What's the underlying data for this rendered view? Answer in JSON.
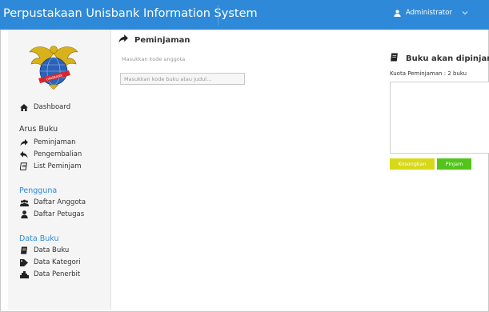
{
  "header": {
    "title": "Perpustakaan Unisbank Information System",
    "user_label": "Administrator"
  },
  "sidebar": {
    "dashboard": "Dashboard",
    "sections": [
      {
        "title": "Arus Buku",
        "items": [
          "Peminjaman",
          "Pengembalian",
          "List Peminjam"
        ]
      },
      {
        "title": "Pengguna",
        "items": [
          "Daftar Anggota",
          "Daftar Petugas"
        ]
      },
      {
        "title": "Data Buku",
        "items": [
          "Data Buku",
          "Data Kategori",
          "Data Penerbit"
        ]
      }
    ]
  },
  "main": {
    "title": "Peminjaman",
    "member_hint": "Masukkan kode anggota",
    "book_input_placeholder": "Masukkan kode buku atau judul...",
    "book_input_value": ""
  },
  "panel": {
    "title": "Buku akan dipinjam",
    "quota": "Kuota Peminjaman : 2 buku",
    "clear_button": "Kosongkan",
    "borrow_button": "Pinjam"
  },
  "colors": {
    "header": "#2e8ad8",
    "section_accent": "#2e8ad8",
    "clear_button": "#d8d818",
    "borrow_button": "#52c41a"
  }
}
